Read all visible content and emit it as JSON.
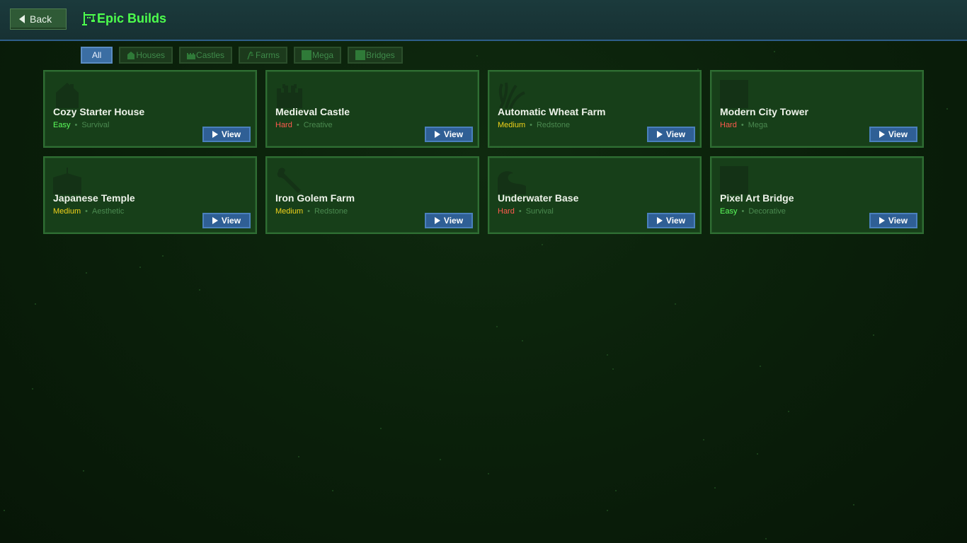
{
  "header": {
    "back_label": "Back",
    "title": "Epic Builds"
  },
  "filters": [
    {
      "label": "All",
      "icon": "",
      "active": true
    },
    {
      "label": "Houses",
      "icon": "house-icon"
    },
    {
      "label": "Castles",
      "icon": "castle-icon"
    },
    {
      "label": "Farms",
      "icon": "wheat-icon"
    },
    {
      "label": "Mega",
      "icon": "block-icon"
    },
    {
      "label": "Bridges",
      "icon": "block-icon"
    }
  ],
  "builds": [
    {
      "name": "Cozy Starter House",
      "difficulty": "Easy",
      "category": "Survival",
      "thumb": "house-icon",
      "view_label": "View"
    },
    {
      "name": "Medieval Castle",
      "difficulty": "Hard",
      "category": "Creative",
      "thumb": "castle-icon",
      "view_label": "View"
    },
    {
      "name": "Automatic Wheat Farm",
      "difficulty": "Medium",
      "category": "Redstone",
      "thumb": "wheat-icon",
      "view_label": "View"
    },
    {
      "name": "Modern City Tower",
      "difficulty": "Hard",
      "category": "Mega",
      "thumb": "tower-block-icon",
      "view_label": "View"
    },
    {
      "name": "Japanese Temple",
      "difficulty": "Medium",
      "category": "Aesthetic",
      "thumb": "temple-icon",
      "view_label": "View"
    },
    {
      "name": "Iron Golem Farm",
      "difficulty": "Medium",
      "category": "Redstone",
      "thumb": "wrench-icon",
      "view_label": "View"
    },
    {
      "name": "Underwater Base",
      "difficulty": "Hard",
      "category": "Survival",
      "thumb": "wave-icon",
      "view_label": "View"
    },
    {
      "name": "Pixel Art Bridge",
      "difficulty": "Easy",
      "category": "Decorative",
      "thumb": "bridge-block-icon",
      "view_label": "View"
    }
  ],
  "colors": {
    "title_green": "#4dff4d",
    "easy": "#5cff5c",
    "medium": "#f1d21a",
    "hard": "#ff5a4d",
    "view_blue": "#2f5f95"
  }
}
